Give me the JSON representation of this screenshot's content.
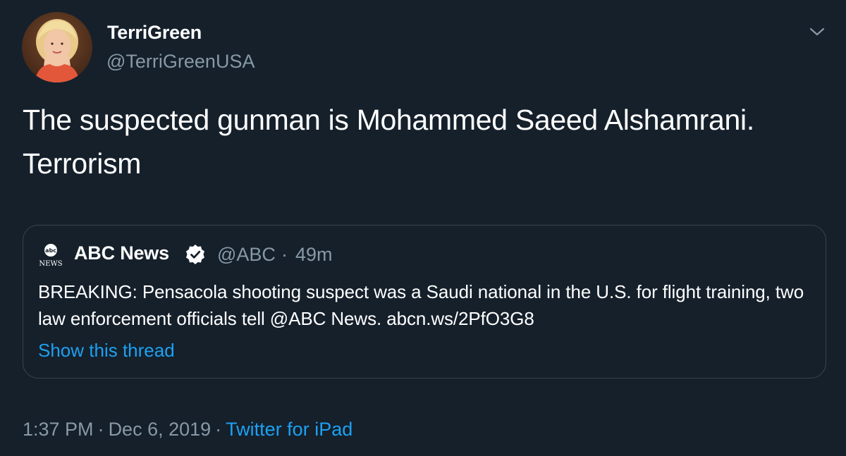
{
  "colors": {
    "background": "#15202b",
    "primary_text": "#ffffff",
    "secondary_text": "#8899a6",
    "link": "#1da1f2",
    "border": "#38444d",
    "verified_badge": "#ffffff"
  },
  "tweet": {
    "author": {
      "display_name": "TerriGreen",
      "handle": "@TerriGreenUSA",
      "avatar_icon": "profile-photo"
    },
    "menu_icon": "chevron-down-icon",
    "text": "The suspected gunman is Mohammed Saeed Alshamrani. Terrorism",
    "quoted": {
      "logo_top": "abc",
      "logo_bottom": "NEWS",
      "display_name": "ABC News",
      "verified_icon": "verified-badge-icon",
      "handle": "@ABC",
      "separator": "·",
      "time": "49m",
      "text": "BREAKING: Pensacola shooting suspect was a Saudi national in the U.S. for flight training,  two law enforcement officials tell @ABC News. abcn.ws/2PfO3G8",
      "show_thread": "Show this thread"
    },
    "meta": {
      "time": "1:37 PM",
      "separator1": "·",
      "date": "Dec 6, 2019",
      "separator2": "·",
      "source": "Twitter for iPad"
    }
  }
}
